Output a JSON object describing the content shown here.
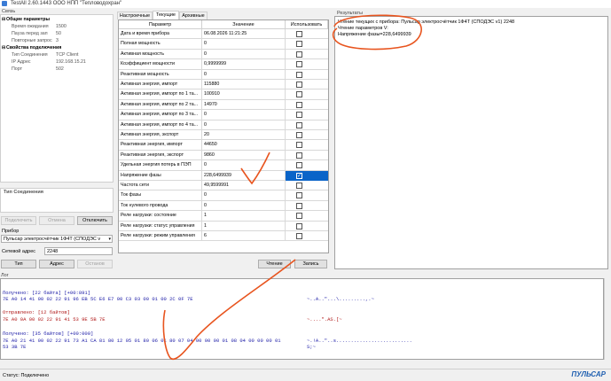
{
  "window": {
    "title": "TestAll 2.60.1443    ООО НПП \"Тепловодохран\""
  },
  "connection": {
    "title": "Связь",
    "cat_general": "Общие параметры",
    "cat_conn": "Свойства подключения",
    "rows_general": [
      {
        "k": "Время ожидания",
        "v": "1500"
      },
      {
        "k": "Пауза перед зап",
        "v": "50"
      },
      {
        "k": "Повторные запрос",
        "v": "3"
      }
    ],
    "rows_conn": [
      {
        "k": "Тип Соединения",
        "v": "TCP Client"
      },
      {
        "k": "IP Адрес",
        "v": "192.168.15.21"
      },
      {
        "k": "Порт",
        "v": "502"
      }
    ],
    "conn_type_label": "Тип Соединения",
    "btn_connect": "Подключить",
    "btn_cancel": "Отмена",
    "btn_disconnect": "Отключить",
    "device_label": "Прибор",
    "device_value": "Пульсар электросчётчик 1Ф4Т (СПОДЭС v",
    "addr_label": "Сетевой адрес",
    "addr_value": "2248",
    "btn_type": "Тип",
    "btn_address": "Адрес",
    "btn_stop": "Останов"
  },
  "tabs": [
    "Настроечные",
    "Текущие",
    "Архивные"
  ],
  "grid": {
    "headers": [
      "Параметр",
      "Значение",
      "Использовать"
    ],
    "rows": [
      {
        "p": "Дата и время прибора",
        "v": "06.08.2026 11:21:25",
        "c": false
      },
      {
        "p": "Полная мощность",
        "v": "0",
        "c": false
      },
      {
        "p": "Активная мощность",
        "v": "0",
        "c": false
      },
      {
        "p": "Коэффициент мощности",
        "v": "0,9999999",
        "c": false
      },
      {
        "p": "Реактивная мощность",
        "v": "0",
        "c": false
      },
      {
        "p": "Активная энергия, импорт",
        "v": "115880",
        "c": false
      },
      {
        "p": "Активная энергия, импорт по 1 та...",
        "v": "100910",
        "c": false
      },
      {
        "p": "Активная энергия, импорт по 2 та...",
        "v": "14970",
        "c": false
      },
      {
        "p": "Активная энергия, импорт по 3 та...",
        "v": "0",
        "c": false
      },
      {
        "p": "Активная энергия, импорт по 4 та...",
        "v": "0",
        "c": false
      },
      {
        "p": "Активная энергия, экспорт",
        "v": "20",
        "c": false
      },
      {
        "p": "Реактивная энергия, импорт",
        "v": "44650",
        "c": false
      },
      {
        "p": "Реактивная энергия, экспорт",
        "v": "9860",
        "c": false
      },
      {
        "p": "Удельная энергия потерь в ПЭП",
        "v": "0",
        "c": false
      },
      {
        "p": "Напряжение фазы",
        "v": "228,6499939",
        "c": true
      },
      {
        "p": "Частота сети",
        "v": "49,9599991",
        "c": false
      },
      {
        "p": "Ток фазы",
        "v": "0",
        "c": false
      },
      {
        "p": "Ток нулевого провода",
        "v": "0",
        "c": false
      },
      {
        "p": "Реле нагрузки: состояние",
        "v": "1",
        "c": false
      },
      {
        "p": "Реле нагрузки: статус управления",
        "v": "1",
        "c": false
      },
      {
        "p": "Реле нагрузки: режим управления",
        "v": "6",
        "c": false
      }
    ],
    "btn_read": "Чтение",
    "btn_write": "Запись"
  },
  "results": {
    "title": "Результаты",
    "lines": [
      "Чтение текущих с прибора: Пульсар электросчётчик 1Ф4Т (СПОДЭС v1) 2248",
      "Чтение параметров  V:",
      "Напряжение фазы=228,6499939"
    ]
  },
  "log": {
    "title": "Лог",
    "lines": [
      {
        "cls": "blue",
        "text": "Получено: [22 байта] [+00:891]",
        "ascii": ""
      },
      {
        "cls": "blue",
        "text": "7E A0 14 41 00 02 22 91 96 EB 5C E6 E7 00 C3 03 00 01 00 2C 0F 7E",
        "ascii": "~..A..\"...\\.........,.~"
      },
      {
        "cls": "red",
        "text": "Отправлено: [12 байтов]",
        "ascii": ""
      },
      {
        "cls": "red",
        "text": "7E A0 0A 00 02 22 91 41 53 9E 5B 7E",
        "ascii": "~....\".AS.[~"
      },
      {
        "cls": "blue",
        "text": "Получено: [35 байтов] [+00:000]",
        "ascii": ""
      },
      {
        "cls": "blue",
        "text": "7E A0 21 41 00 02 22 91 73 A1 CA 81 80 12 05 01 80 06 01 80 07 04 00 00 00 01 08 04 00 00 00 01",
        "ascii": "~.!A..\"..s.........................."
      },
      {
        "cls": "blue",
        "text": "53 3B 7E",
        "ascii": "S;~"
      }
    ]
  },
  "status": {
    "text": "Статус: Подключено",
    "logo": "ПУЛЬСАР"
  },
  "colors": {
    "selection": "#0a64c8",
    "annotation": "#e8541e"
  }
}
